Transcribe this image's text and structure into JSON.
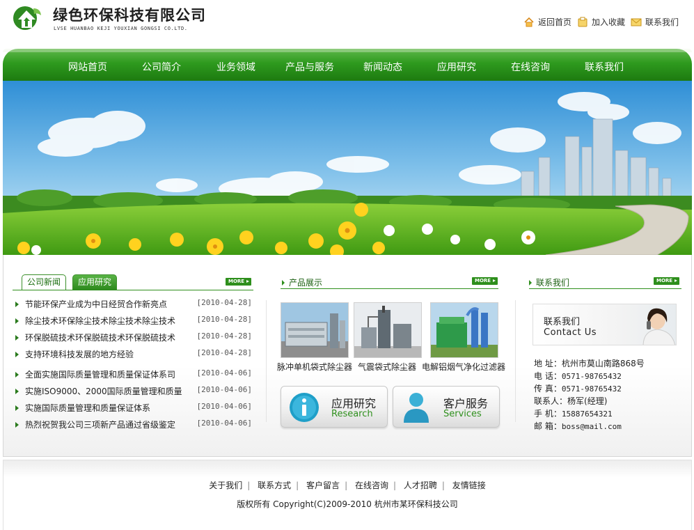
{
  "header": {
    "title_cn": "绿色环保科技有限公司",
    "title_en": "LVSE HUANBAO KEJI YOUXIAN GONGSI CO.LTD.",
    "links": [
      {
        "label": "返回首页",
        "icon": "home-icon"
      },
      {
        "label": "加入收藏",
        "icon": "favorite-icon"
      },
      {
        "label": "联系我们",
        "icon": "mail-icon"
      }
    ]
  },
  "nav": [
    "网站首页",
    "公司简介",
    "业务领域",
    "产品与服务",
    "新闻动态",
    "应用研究",
    "在线咨询",
    "联系我们"
  ],
  "news": {
    "tabs": [
      "公司新闻",
      "应用研究"
    ],
    "more": "MORE",
    "items": [
      {
        "title": "节能环保产业成为中日经贸合作新亮点",
        "date": "[2010-04-28]"
      },
      {
        "title": "除尘技术环保除尘技术除尘技术除尘技术",
        "date": "[2010-04-28]"
      },
      {
        "title": "环保脱硫技术环保脱硫技术环保脱硫技术",
        "date": "[2010-04-28]"
      },
      {
        "title": "支持环境科技发展的地方经验",
        "date": "[2010-04-28]"
      },
      {
        "title": "全面实施国际质量管理和质量保证体系司",
        "date": "[2010-04-06]"
      },
      {
        "title": "实施ISO9000、2000国际质量管理和质量",
        "date": "[2010-04-06]"
      },
      {
        "title": "实施国际质量管理和质量保证体系",
        "date": "[2010-04-06]"
      },
      {
        "title": "热烈祝贺我公司三项新产品通过省级鉴定",
        "date": "[2010-04-06]"
      }
    ]
  },
  "products": {
    "heading": "产品展示",
    "more": "MORE",
    "items": [
      "脉冲单机袋式除尘器",
      "气震袋式除尘器",
      "电解铝烟气净化过滤器"
    ]
  },
  "services": [
    {
      "zh": "应用研究",
      "en": "Research",
      "icon": "info-icon"
    },
    {
      "zh": "客户服务",
      "en": "Services",
      "icon": "user-icon"
    }
  ],
  "contact": {
    "heading": "联系我们",
    "more": "MORE",
    "banner_zh": "联系我们",
    "banner_en": "Contact Us",
    "rows": [
      {
        "label": "地  址：",
        "value": "杭州市莫山南路868号"
      },
      {
        "label": "电  话：",
        "value": "0571-98765432"
      },
      {
        "label": "传  真：",
        "value": "0571-98765432"
      },
      {
        "label": "联系人：",
        "value": "杨军(经理)"
      },
      {
        "label": "手  机：",
        "value": "15887654321"
      },
      {
        "label": "邮  箱：",
        "value": "boss@mail.com"
      }
    ]
  },
  "footer": {
    "links": [
      "关于我们",
      "联系方式",
      "客户留言",
      "在线咨询",
      "人才招聘",
      "友情链接"
    ],
    "separator": "|",
    "copyright": "版权所有  Copyright(C)2009-2010 杭州市某环保科技公司"
  },
  "colors": {
    "brand_green": "#2e8f1c",
    "nav_top": "#5fb84a",
    "nav_bottom": "#1d7a10"
  }
}
